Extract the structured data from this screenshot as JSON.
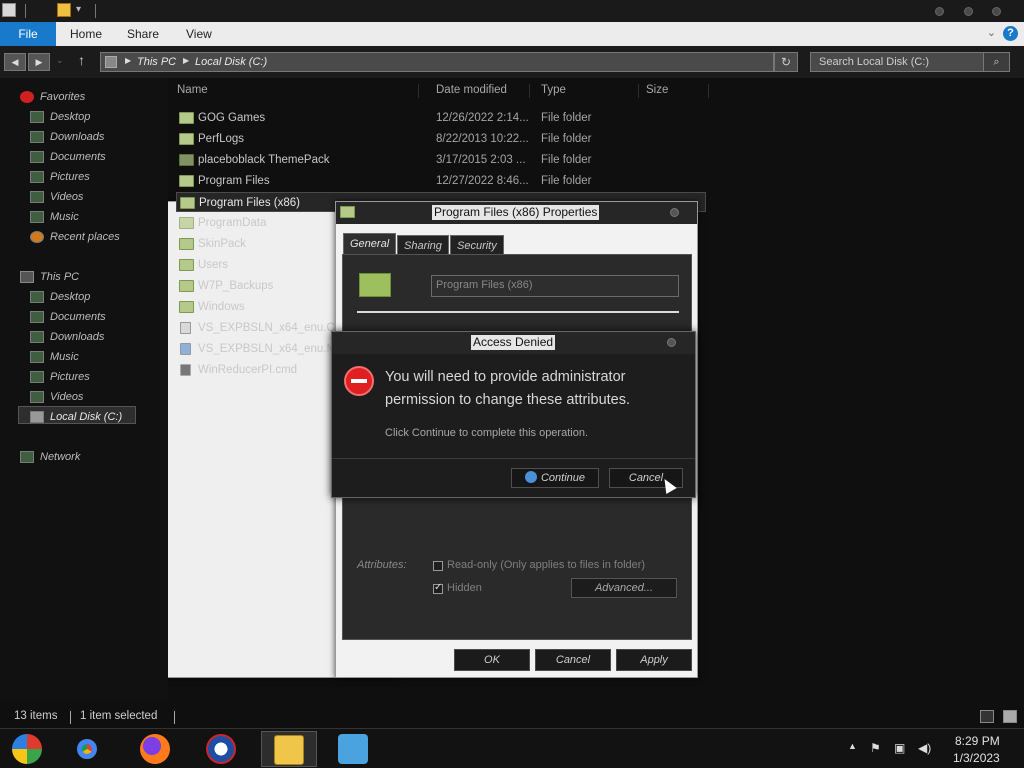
{
  "ribbon": {
    "tabs": [
      "File",
      "Home",
      "Share",
      "View"
    ]
  },
  "address": {
    "crumbs": [
      "This PC",
      "Local Disk (C:)"
    ],
    "search_placeholder": "Search Local Disk (C:)"
  },
  "nav": {
    "favorites": {
      "label": "Favorites",
      "items": [
        "Desktop",
        "Downloads",
        "Documents",
        "Pictures",
        "Videos",
        "Music",
        "Recent places"
      ]
    },
    "thispc": {
      "label": "This PC",
      "items": [
        "Desktop",
        "Documents",
        "Downloads",
        "Music",
        "Pictures",
        "Videos",
        "Local Disk (C:)"
      ]
    },
    "network": "Network"
  },
  "columns": {
    "name": "Name",
    "date": "Date modified",
    "type": "Type",
    "size": "Size"
  },
  "files": [
    {
      "name": "GOG Games",
      "date": "12/26/2022 2:14...",
      "type": "File folder"
    },
    {
      "name": "PerfLogs",
      "date": "8/22/2013 10:22...",
      "type": "File folder"
    },
    {
      "name": "placeboblack ThemePack",
      "date": "3/17/2015 2:03 ...",
      "type": "File folder"
    },
    {
      "name": "Program Files",
      "date": "12/27/2022 8:46...",
      "type": "File folder"
    },
    {
      "name": "Program Files (x86)",
      "date": "",
      "type": ""
    },
    {
      "name": "ProgramData",
      "date": "",
      "type": ""
    },
    {
      "name": "SkinPack",
      "date": "",
      "type": ""
    },
    {
      "name": "Users",
      "date": "",
      "type": ""
    },
    {
      "name": "W7P_Backups",
      "date": "",
      "type": ""
    },
    {
      "name": "Windows",
      "date": "",
      "type": ""
    },
    {
      "name": "VS_EXPBSLN_x64_enu.CAB",
      "date": "",
      "type": ""
    },
    {
      "name": "VS_EXPBSLN_x64_enu.MSI",
      "date": "",
      "type": ""
    },
    {
      "name": "WinReducerPI.cmd",
      "date": "",
      "type": ""
    }
  ],
  "properties": {
    "title": "Program Files (x86) Properties",
    "tabs": [
      "General",
      "Sharing",
      "Security"
    ],
    "name_value": "Program Files (x86)",
    "attributes_label": "Attributes:",
    "readonly_label": "Read-only (Only applies to files in folder)",
    "hidden_label": "Hidden",
    "advanced_label": "Advanced...",
    "ok": "OK",
    "cancel": "Cancel",
    "apply": "Apply"
  },
  "denied": {
    "title": "Access Denied",
    "message": "You will need to provide administrator permission to change these attributes.",
    "sub": "Click Continue to complete this operation.",
    "continue": "Continue",
    "cancel": "Cancel"
  },
  "status": {
    "items": "13 items",
    "selected": "1 item selected"
  },
  "clock": {
    "time": "8:29 PM",
    "date": "1/3/2023"
  }
}
